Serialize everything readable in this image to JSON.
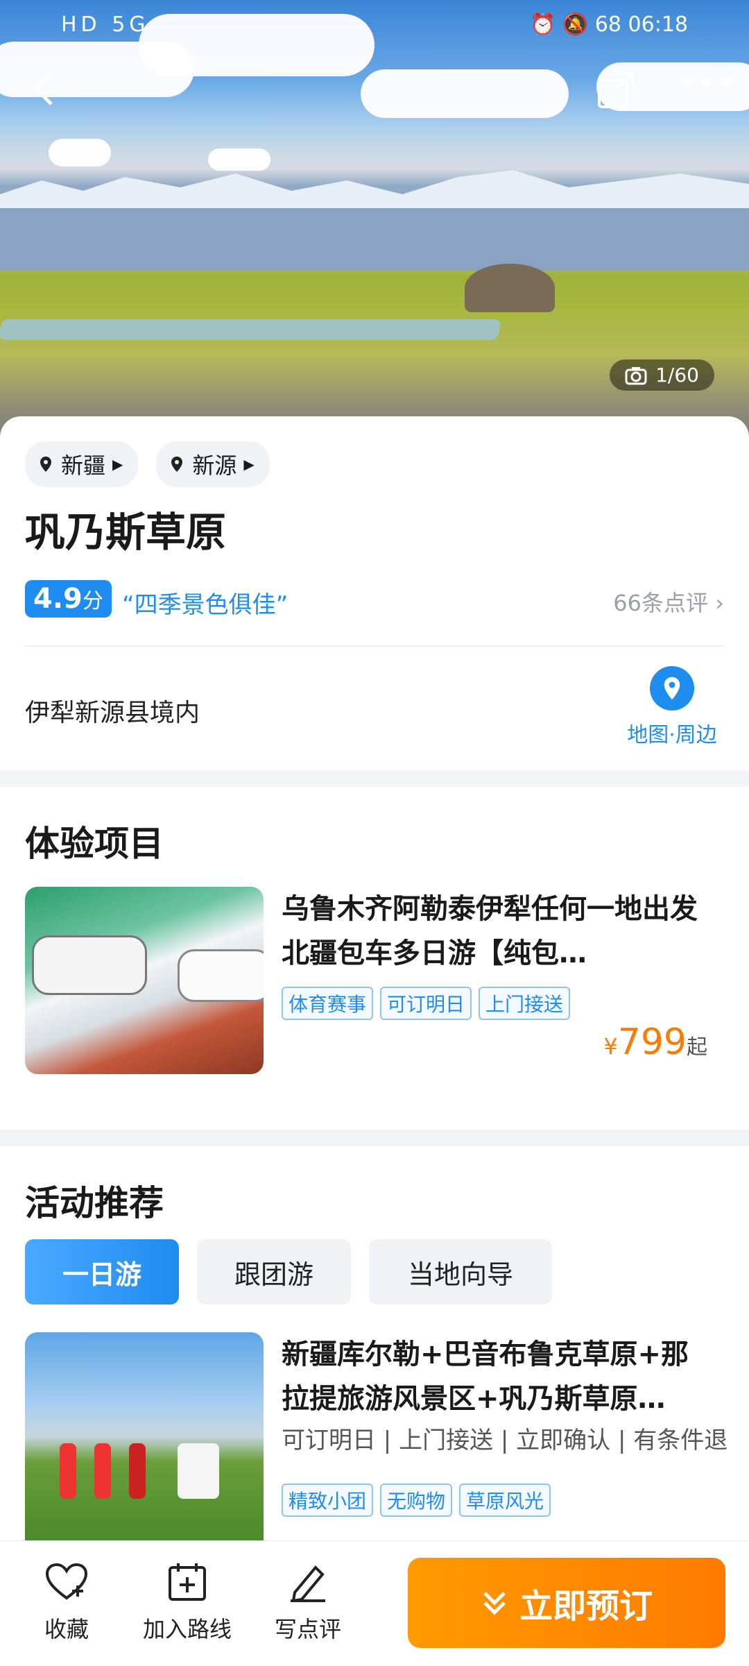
{
  "status": {
    "left": "HD 5G",
    "time": "06:18",
    "battery": "68"
  },
  "hero": {
    "photo_count": "1/60"
  },
  "breadcrumbs": [
    {
      "label": "新疆"
    },
    {
      "label": "新源"
    }
  ],
  "attraction": {
    "name": "巩乃斯草原",
    "score": "4.9",
    "score_unit": "分",
    "quote": "“四季景色俱佳”",
    "review_count": "66条点评",
    "address": "伊犁新源县境内",
    "map_label": "地图·周边"
  },
  "experience": {
    "title": "体验项目",
    "item": {
      "title": "乌鲁木齐阿勒泰伊犁任何一地出发北疆包车多日游【纯包…",
      "tags": [
        "体育赛事",
        "可订明日",
        "上门接送"
      ],
      "price_symbol": "¥",
      "price": "799",
      "price_suffix": "起"
    }
  },
  "activities": {
    "title": "活动推荐",
    "tabs": [
      "一日游",
      "跟团游",
      "当地向导"
    ],
    "active_tab": "一日游",
    "item": {
      "title": "新疆库尔勒+巴音布鲁克草原+那拉提旅游风景区+巩乃斯草原…",
      "features": "可订明日 | 上门接送 | 立即确认 | 有条件退",
      "tags": [
        "精致小团",
        "无购物",
        "草原风光"
      ]
    }
  },
  "bottom_bar": {
    "favorite": "收藏",
    "add_route": "加入路线",
    "write_review": "写点评",
    "book": "立即预订"
  },
  "colors": {
    "primary": "#1f8cf0",
    "accent": "#ff7a00"
  }
}
